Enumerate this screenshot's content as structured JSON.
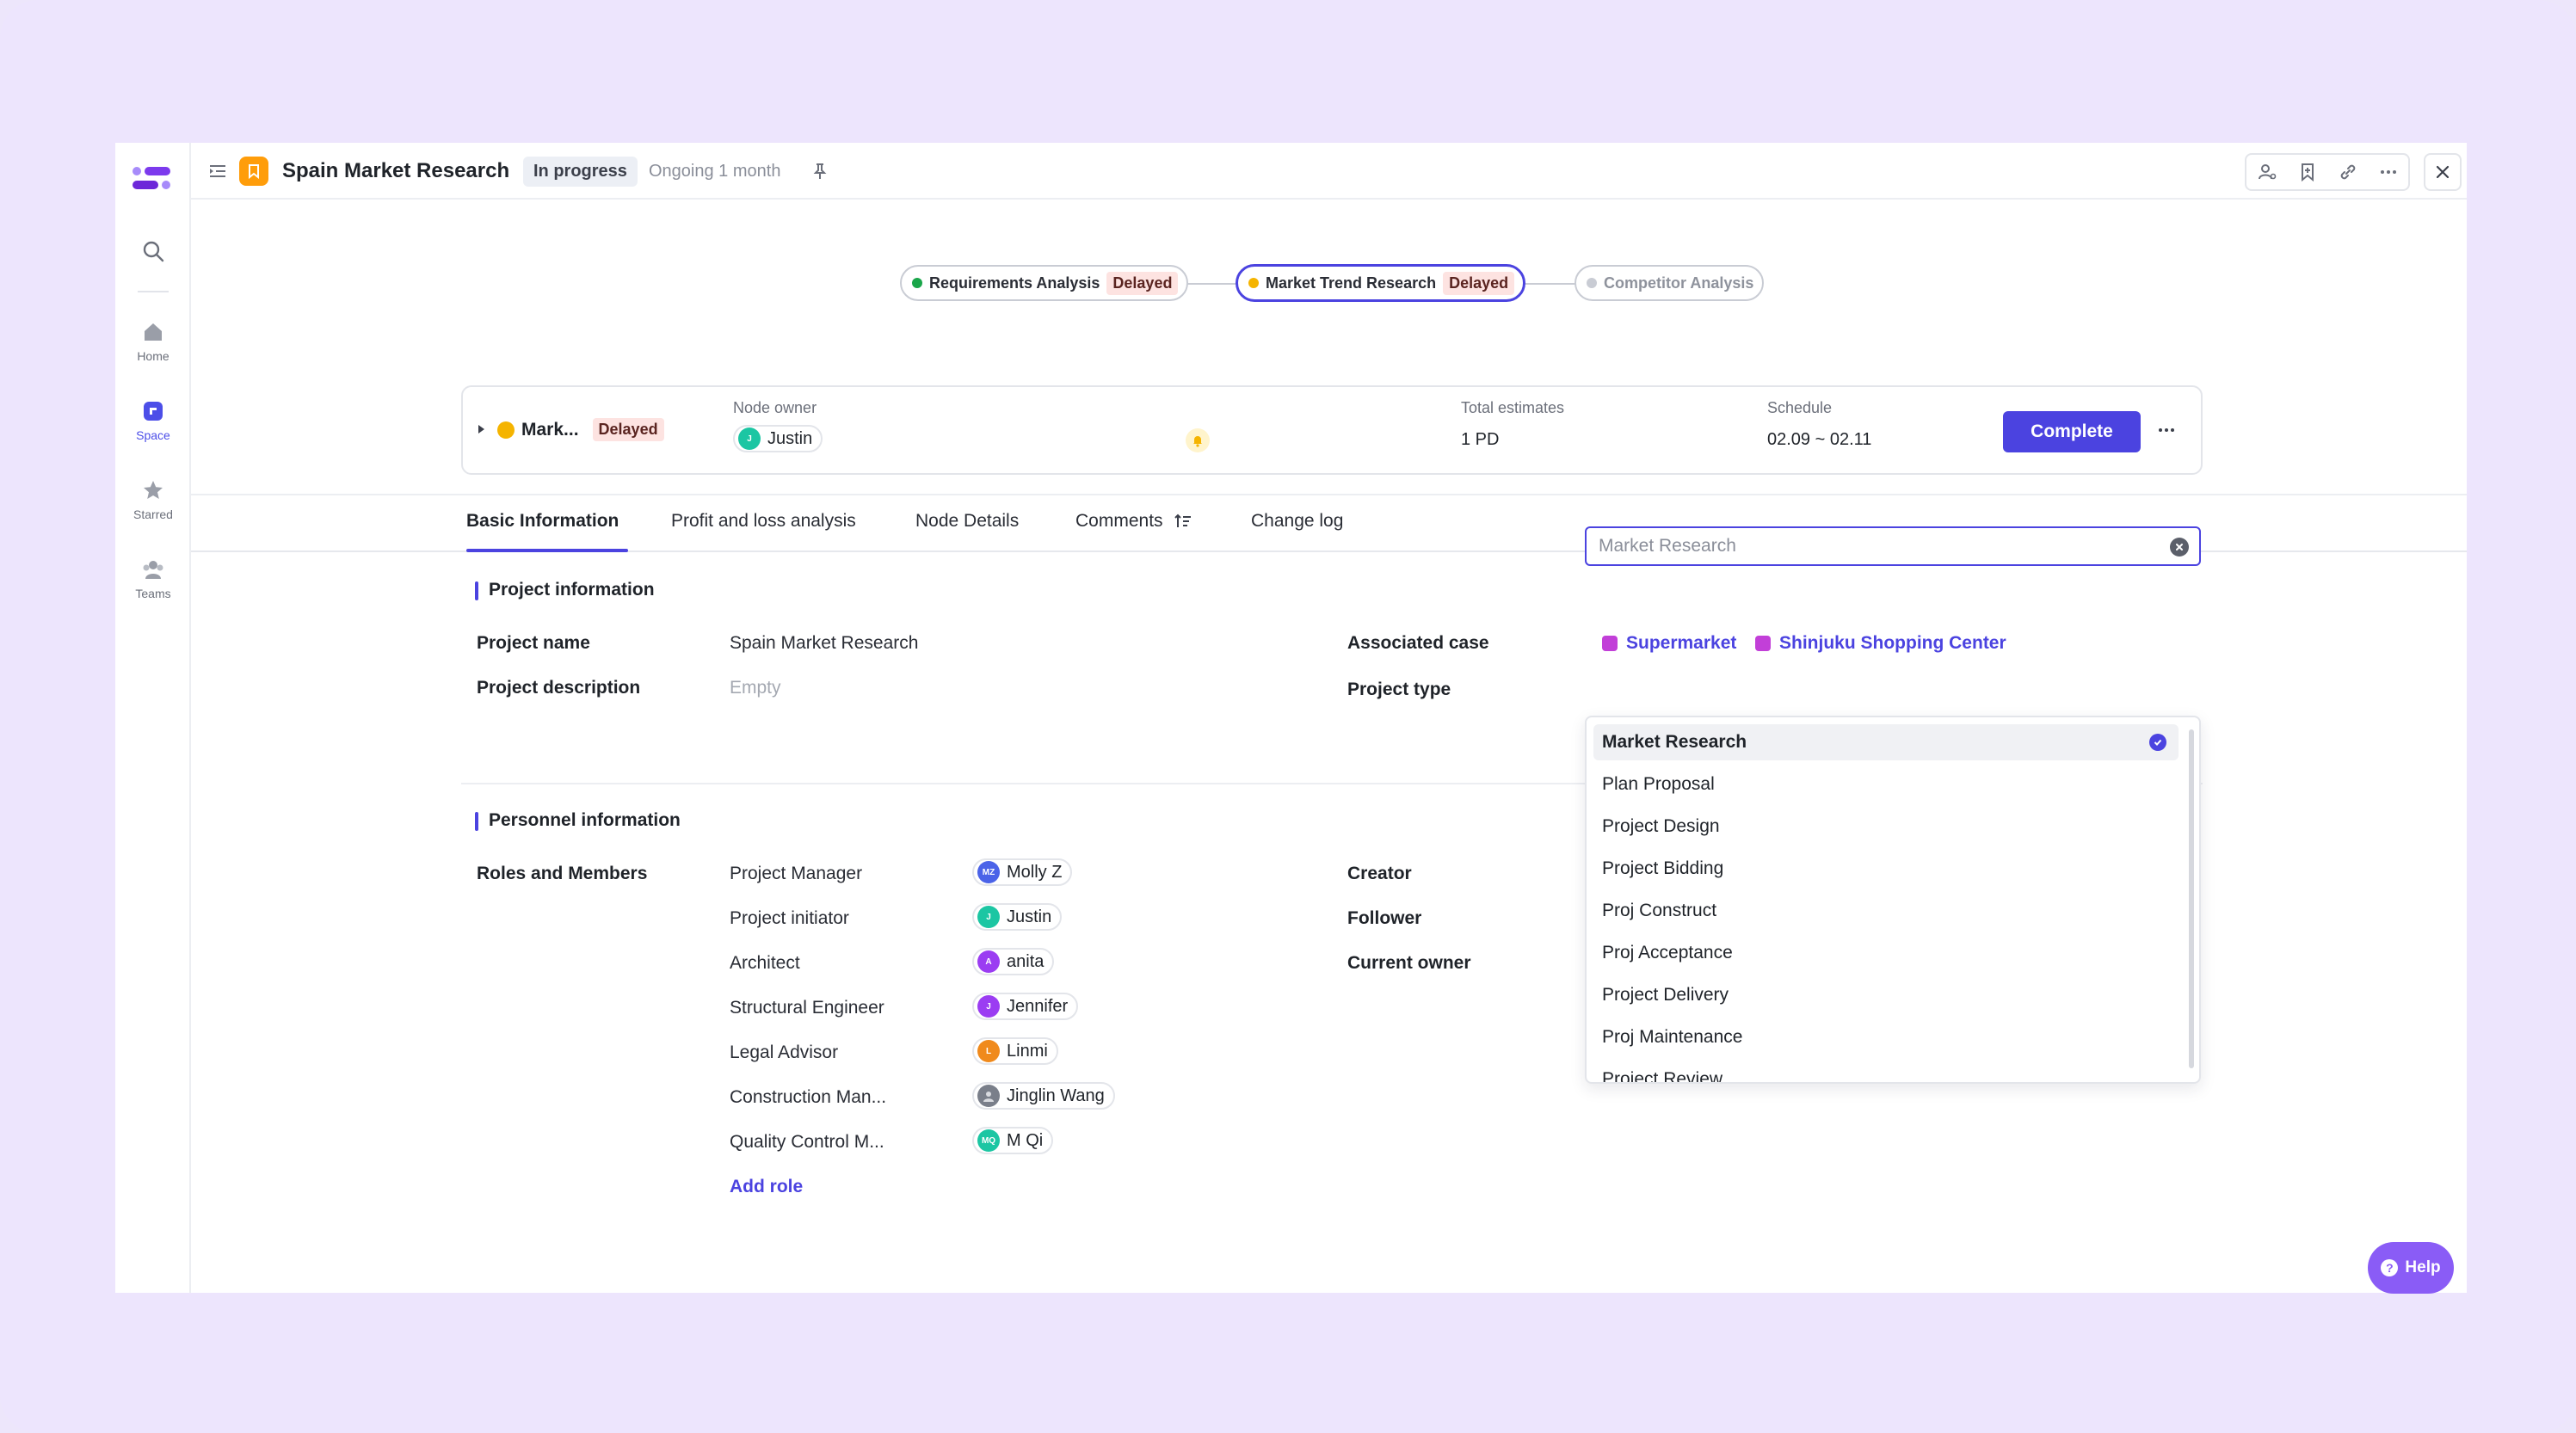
{
  "rail": {
    "items": [
      {
        "label": "Home"
      },
      {
        "label": "Space"
      },
      {
        "label": "Starred"
      },
      {
        "label": "Teams"
      }
    ]
  },
  "header": {
    "title": "Spain Market Research",
    "status": "In progress",
    "duration": "Ongoing 1 month"
  },
  "flow": {
    "nodes": [
      {
        "label": "Requirements Analysis",
        "badge": "Delayed",
        "dot_color": "#1aa64a"
      },
      {
        "label": "Market Trend Research",
        "badge": "Delayed",
        "dot_color": "#f5b400"
      },
      {
        "label": "Competitor Analysis",
        "badge": "",
        "dot_color": "#c9ccd4"
      }
    ]
  },
  "node_card": {
    "name": "Mark...",
    "badge": "Delayed",
    "owner_label": "Node owner",
    "owner": "Justin",
    "estimates_label": "Total estimates",
    "estimates": "1 PD",
    "schedule_label": "Schedule",
    "schedule": "02.09 ~ 02.11",
    "complete_label": "Complete"
  },
  "tabs": [
    {
      "label": "Basic Information"
    },
    {
      "label": "Profit and loss analysis"
    },
    {
      "label": "Node Details"
    },
    {
      "label": "Comments"
    },
    {
      "label": "Change log"
    }
  ],
  "project_info": {
    "section_title": "Project information",
    "name_label": "Project name",
    "name_value": "Spain Market Research",
    "desc_label": "Project description",
    "desc_value": "Empty",
    "case_label": "Associated case",
    "cases": [
      "Supermarket",
      "Shinjuku Shopping Center"
    ],
    "type_label": "Project type",
    "type_placeholder": "Market Research"
  },
  "dropdown": {
    "options": [
      "Market Research",
      "Plan Proposal",
      "Project Design",
      "Project Bidding",
      "Proj Construct",
      "Proj Acceptance",
      "Project Delivery",
      "Proj Maintenance",
      "Project Review"
    ],
    "selected": "Market Research"
  },
  "personnel": {
    "section_title": "Personnel information",
    "roles_label": "Roles and Members",
    "roles": [
      {
        "role": "Project Manager",
        "member": "Molly Z",
        "initials": "MZ",
        "color": "#4b63e8"
      },
      {
        "role": "Project initiator",
        "member": "Justin",
        "initials": "J",
        "color": "#1cc6a3"
      },
      {
        "role": "Architect",
        "member": "anita",
        "initials": "A",
        "color": "#9b3df2"
      },
      {
        "role": "Structural Engineer",
        "member": "Jennifer",
        "initials": "J",
        "color": "#9b3df2"
      },
      {
        "role": "Legal Advisor",
        "member": "Linmi",
        "initials": "L",
        "color": "#f08a1c"
      },
      {
        "role": "Construction Man...",
        "member": "Jinglin Wang",
        "initials": "",
        "color": "#7a7f8a"
      },
      {
        "role": "Quality Control M...",
        "member": "M Qi",
        "initials": "MQ",
        "color": "#1cc6a3"
      }
    ],
    "add_role": "Add role",
    "creator_label": "Creator",
    "follower_label": "Follower",
    "current_owner_label": "Current owner"
  },
  "help": {
    "label": "Help"
  }
}
